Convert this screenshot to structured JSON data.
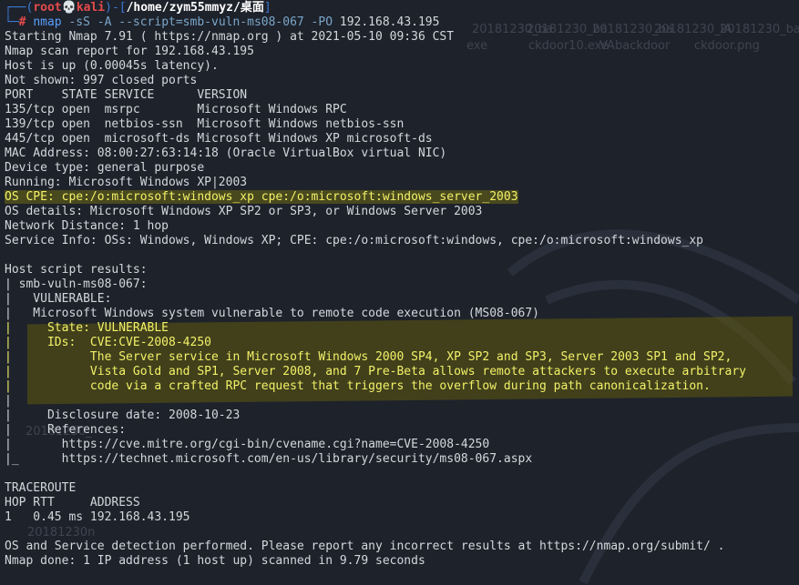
{
  "prompt": {
    "corner": "┌──(",
    "user": "root",
    "skull": "💀",
    "host": "kali",
    "sep": ")-[",
    "path": "/home/zym55mmyz/桌面",
    "close": "]",
    "prefix": "└─",
    "hash": "#",
    "command": "nmap",
    "args": "-sS -A --script=smb-vuln-ms08-067 -PO",
    "target": "192.168.43.195"
  },
  "output": {
    "lines": [
      "Starting Nmap 7.91 ( https://nmap.org ) at 2021-05-10 09:36 CST",
      "Nmap scan report for 192.168.43.195",
      "Host is up (0.00045s latency).",
      "Not shown: 997 closed ports",
      "PORT    STATE SERVICE      VERSION",
      "135/tcp open  msrpc        Microsoft Windows RPC",
      "139/tcp open  netbios-ssn  Microsoft Windows netbios-ssn",
      "445/tcp open  microsoft-ds Microsoft Windows XP microsoft-ds",
      "MAC Address: 08:00:27:63:14:18 (Oracle VirtualBox virtual NIC)",
      "Device type: general purpose",
      "Running: Microsoft Windows XP|2003",
      "OS CPE: cpe:/o:microsoft:windows_xp cpe:/o:microsoft:windows_server_2003",
      "OS details: Microsoft Windows XP SP2 or SP3, or Windows Server 2003",
      "Network Distance: 1 hop",
      "Service Info: OSs: Windows, Windows XP; CPE: cpe:/o:microsoft:windows, cpe:/o:microsoft:windows_xp",
      "",
      "Host script results:",
      "| smb-vuln-ms08-067:",
      "|   VULNERABLE:",
      "|   Microsoft Windows system vulnerable to remote code execution (MS08-067)",
      "|     State: VULNERABLE",
      "|     IDs:  CVE:CVE-2008-4250",
      "|           The Server service in Microsoft Windows 2000 SP4, XP SP2 and SP3, Server 2003 SP1 and SP2,",
      "|           Vista Gold and SP1, Server 2008, and 7 Pre-Beta allows remote attackers to execute arbitrary",
      "|           code via a crafted RPC request that triggers the overflow during path canonicalization.",
      "|",
      "|     Disclosure date: 2008-10-23",
      "|     References:",
      "|       https://cve.mitre.org/cgi-bin/cvename.cgi?name=CVE-2008-4250",
      "|_      https://technet.microsoft.com/en-us/library/security/ms08-067.aspx",
      "",
      "TRACEROUTE",
      "HOP RTT     ADDRESS",
      "1   0.45 ms 192.168.43.195",
      "",
      "OS and Service detection performed. Please report any incorrect results at https://nmap.org/submit/ .",
      "Nmap done: 1 IP address (1 host up) scanned in 9.79 seconds"
    ]
  },
  "desktop_icons": {
    "top": [
      "20181230_ba",
      "20181230_ba",
      "20181230_ba",
      "20181230_IA",
      "20181230_ba"
    ],
    "bottom": [
      "exe",
      "ckdoor10.exe",
      "VAbackdoor",
      "ckdoor.png"
    ],
    "left_1": "20181230_",
    "left_2": "20181230n"
  },
  "colors": {
    "background": "#1e222b",
    "text": "#d4d7dc",
    "highlight_bg": "#6e6914",
    "highlight_text": "#f3f168",
    "prompt_blue": "#3a7bd5",
    "prompt_red": "#e64b4b"
  }
}
